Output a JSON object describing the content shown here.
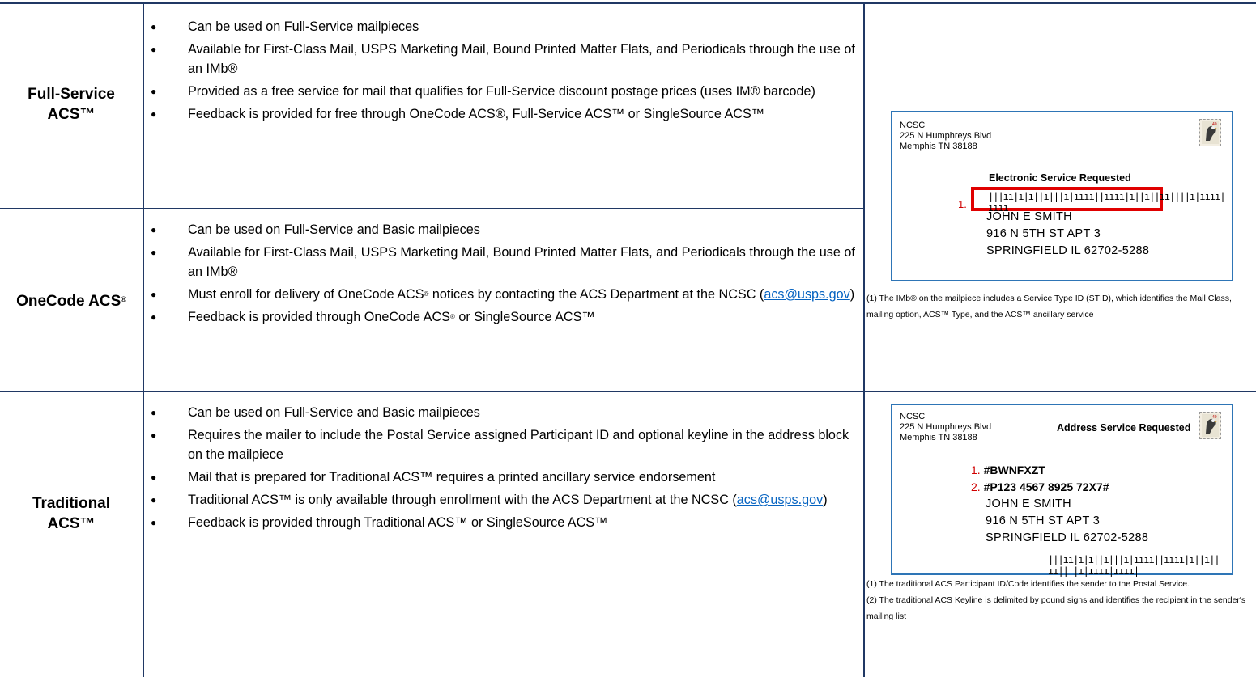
{
  "rows": [
    {
      "label": "Full-Service ACS™",
      "label_lines": [
        "Full-Service",
        "ACS™"
      ],
      "bullets": [
        "Can be used on Full-Service mailpieces",
        "Available for First-Class Mail, USPS Marketing Mail, Bound Printed Matter Flats, and Periodicals through the use of an IMb®",
        "Provided as a free service for mail that qualifies for Full-Service discount postage prices (uses IM® barcode)",
        "Feedback is provided for free through OneCode ACS®, Full-Service ACS™ or SingleSource ACS™"
      ]
    },
    {
      "label": "OneCode ACS",
      "label_sup": "®",
      "bullets": [
        "Can be used on Full-Service and Basic mailpieces",
        "Available for First-Class Mail, USPS Marketing Mail, Bound Printed Matter Flats, and Periodicals through the use of an IMb®",
        {
          "before": "Must enroll for delivery of OneCode ACS",
          "sup": "®",
          "after": " notices by contacting the ACS Department at the NCSC (",
          "link": "acs@usps.gov",
          "end": ")"
        },
        {
          "before": "Feedback is provided through OneCode ACS",
          "sup": "®",
          "after": " or SingleSource ACS™"
        }
      ]
    },
    {
      "label_lines": [
        "Traditional",
        "ACS™"
      ],
      "bullets": [
        "Can be used on Full-Service and Basic mailpieces",
        "Requires the mailer to include the Postal Service assigned Participant ID and optional keyline in the address block on the mailpiece",
        "Mail that is prepared for Traditional ACS™ requires a printed ancillary service endorsement",
        {
          "before": "Traditional ACS™  is only available through enrollment with the ACS Department at the NCSC (",
          "link": "acs@usps.gov",
          "end": ")"
        },
        "Feedback is provided through Traditional ACS™ or SingleSource ACS™"
      ]
    }
  ],
  "envelope1": {
    "sender": [
      "NCSC",
      "225 N Humphreys Blvd",
      "Memphis TN 38188"
    ],
    "endorsement": "Electronic Service Requested",
    "marker": "1.",
    "barcode": "|||ıı|ı|ı||ı|||ı|ıııı||ıııı|ı||ı||ıı||||ı|ıııı|ıııı|",
    "address": [
      "JOHN E SMITH",
      "916 N 5TH ST APT 3",
      "SPRINGFIELD IL  62702-5288"
    ],
    "stamp_value": "40",
    "caption": "(1) The IMb®  on the mailpiece includes a Service Type ID (STID), which identifies the Mail Class, mailing option, ACS™ Type, and the ACS™ ancillary service"
  },
  "envelope2": {
    "sender": [
      "NCSC",
      "225 N Humphreys Blvd",
      "Memphis TN 38188"
    ],
    "endorsement": "Address Service Requested",
    "marker1": "1.",
    "participant_id": "#BWNFXZT",
    "marker2": "2.",
    "keyline": "#P123 4567 8925 72X7#",
    "address": [
      "JOHN E SMITH",
      "916 N 5TH ST APT 3",
      "SPRINGFIELD IL  62702-5288"
    ],
    "barcode": "|||ıı|ı|ı||ı|||ı|ıııı||ıııı|ı||ı||ıı||||ı|ıııı|ıııı|",
    "stamp_value": "40",
    "captions": [
      "(1) The traditional ACS Participant ID/Code identifies the sender to the Postal Service.",
      "(2) The traditional ACS Keyline is delimited by pound signs and identifies the recipient in the sender's mailing list"
    ]
  },
  "colors": {
    "border": "#203864",
    "envelope_border": "#2e75b6",
    "highlight": "#e00000",
    "link": "#0563c1",
    "marker": "#d00000"
  }
}
